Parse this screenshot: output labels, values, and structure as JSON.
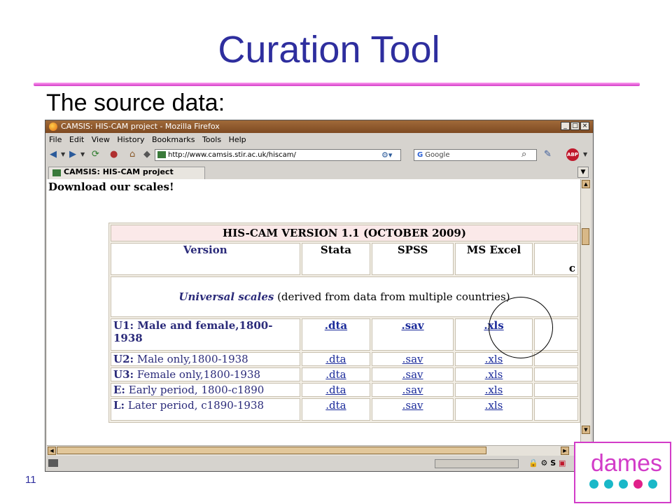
{
  "slide": {
    "title": "Curation Tool",
    "subtitle": "The source data:",
    "page_number": "11",
    "logo_text": "dames"
  },
  "browser": {
    "window_title": "CAMSIS: HIS-CAM project - Mozilla Firefox",
    "menu": [
      "File",
      "Edit",
      "View",
      "History",
      "Bookmarks",
      "Tools",
      "Help"
    ],
    "url": "http://www.camsis.stir.ac.uk/hiscam/",
    "search_placeholder": "Google",
    "tab_label": "CAMSIS: HIS-CAM project",
    "adblock_label": "ABP"
  },
  "page": {
    "heading": "Download our scales!",
    "table": {
      "caption": "HIS-CAM VERSION 1.1 (OCTOBER 2009)",
      "columns": [
        "Version",
        "Stata",
        "SPSS",
        "MS Excel",
        "c"
      ],
      "section_bold": "Universal scales",
      "section_rest": " (derived from data from multiple countries)",
      "rows": [
        {
          "code": "U1:",
          "desc": " Male and female,1800-1938",
          "stata": ".dta",
          "spss": ".sav",
          "excel": ".xls"
        },
        {
          "code": "U2:",
          "desc": " Male only,1800-1938",
          "stata": ".dta",
          "spss": ".sav",
          "excel": ".xls"
        },
        {
          "code": "U3:",
          "desc": " Female only,1800-1938",
          "stata": ".dta",
          "spss": ".sav",
          "excel": ".xls"
        },
        {
          "code": "E:",
          "desc": " Early period, 1800-c1890",
          "stata": ".dta",
          "spss": ".sav",
          "excel": ".xls"
        },
        {
          "code": "L:",
          "desc": " Later period, c1890-1938",
          "stata": ".dta",
          "spss": ".sav",
          "excel": ".xls"
        }
      ]
    }
  },
  "colors": {
    "title": "#2e2e9e",
    "accent_pink": "#d23cc8",
    "dot_teal": "#19b8c8",
    "dot_pink": "#e0208a"
  }
}
